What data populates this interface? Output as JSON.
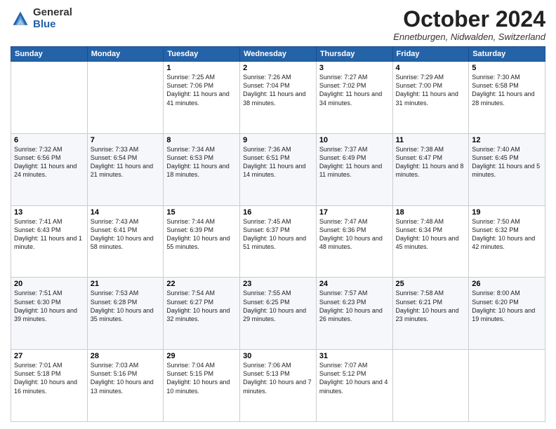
{
  "logo": {
    "general": "General",
    "blue": "Blue"
  },
  "title": "October 2024",
  "location": "Ennetburgen, Nidwalden, Switzerland",
  "days_of_week": [
    "Sunday",
    "Monday",
    "Tuesday",
    "Wednesday",
    "Thursday",
    "Friday",
    "Saturday"
  ],
  "weeks": [
    [
      {
        "day": "",
        "sunrise": "",
        "sunset": "",
        "daylight": ""
      },
      {
        "day": "",
        "sunrise": "",
        "sunset": "",
        "daylight": ""
      },
      {
        "day": "1",
        "sunrise": "Sunrise: 7:25 AM",
        "sunset": "Sunset: 7:06 PM",
        "daylight": "Daylight: 11 hours and 41 minutes."
      },
      {
        "day": "2",
        "sunrise": "Sunrise: 7:26 AM",
        "sunset": "Sunset: 7:04 PM",
        "daylight": "Daylight: 11 hours and 38 minutes."
      },
      {
        "day": "3",
        "sunrise": "Sunrise: 7:27 AM",
        "sunset": "Sunset: 7:02 PM",
        "daylight": "Daylight: 11 hours and 34 minutes."
      },
      {
        "day": "4",
        "sunrise": "Sunrise: 7:29 AM",
        "sunset": "Sunset: 7:00 PM",
        "daylight": "Daylight: 11 hours and 31 minutes."
      },
      {
        "day": "5",
        "sunrise": "Sunrise: 7:30 AM",
        "sunset": "Sunset: 6:58 PM",
        "daylight": "Daylight: 11 hours and 28 minutes."
      }
    ],
    [
      {
        "day": "6",
        "sunrise": "Sunrise: 7:32 AM",
        "sunset": "Sunset: 6:56 PM",
        "daylight": "Daylight: 11 hours and 24 minutes."
      },
      {
        "day": "7",
        "sunrise": "Sunrise: 7:33 AM",
        "sunset": "Sunset: 6:54 PM",
        "daylight": "Daylight: 11 hours and 21 minutes."
      },
      {
        "day": "8",
        "sunrise": "Sunrise: 7:34 AM",
        "sunset": "Sunset: 6:53 PM",
        "daylight": "Daylight: 11 hours and 18 minutes."
      },
      {
        "day": "9",
        "sunrise": "Sunrise: 7:36 AM",
        "sunset": "Sunset: 6:51 PM",
        "daylight": "Daylight: 11 hours and 14 minutes."
      },
      {
        "day": "10",
        "sunrise": "Sunrise: 7:37 AM",
        "sunset": "Sunset: 6:49 PM",
        "daylight": "Daylight: 11 hours and 11 minutes."
      },
      {
        "day": "11",
        "sunrise": "Sunrise: 7:38 AM",
        "sunset": "Sunset: 6:47 PM",
        "daylight": "Daylight: 11 hours and 8 minutes."
      },
      {
        "day": "12",
        "sunrise": "Sunrise: 7:40 AM",
        "sunset": "Sunset: 6:45 PM",
        "daylight": "Daylight: 11 hours and 5 minutes."
      }
    ],
    [
      {
        "day": "13",
        "sunrise": "Sunrise: 7:41 AM",
        "sunset": "Sunset: 6:43 PM",
        "daylight": "Daylight: 11 hours and 1 minute."
      },
      {
        "day": "14",
        "sunrise": "Sunrise: 7:43 AM",
        "sunset": "Sunset: 6:41 PM",
        "daylight": "Daylight: 10 hours and 58 minutes."
      },
      {
        "day": "15",
        "sunrise": "Sunrise: 7:44 AM",
        "sunset": "Sunset: 6:39 PM",
        "daylight": "Daylight: 10 hours and 55 minutes."
      },
      {
        "day": "16",
        "sunrise": "Sunrise: 7:45 AM",
        "sunset": "Sunset: 6:37 PM",
        "daylight": "Daylight: 10 hours and 51 minutes."
      },
      {
        "day": "17",
        "sunrise": "Sunrise: 7:47 AM",
        "sunset": "Sunset: 6:36 PM",
        "daylight": "Daylight: 10 hours and 48 minutes."
      },
      {
        "day": "18",
        "sunrise": "Sunrise: 7:48 AM",
        "sunset": "Sunset: 6:34 PM",
        "daylight": "Daylight: 10 hours and 45 minutes."
      },
      {
        "day": "19",
        "sunrise": "Sunrise: 7:50 AM",
        "sunset": "Sunset: 6:32 PM",
        "daylight": "Daylight: 10 hours and 42 minutes."
      }
    ],
    [
      {
        "day": "20",
        "sunrise": "Sunrise: 7:51 AM",
        "sunset": "Sunset: 6:30 PM",
        "daylight": "Daylight: 10 hours and 39 minutes."
      },
      {
        "day": "21",
        "sunrise": "Sunrise: 7:53 AM",
        "sunset": "Sunset: 6:28 PM",
        "daylight": "Daylight: 10 hours and 35 minutes."
      },
      {
        "day": "22",
        "sunrise": "Sunrise: 7:54 AM",
        "sunset": "Sunset: 6:27 PM",
        "daylight": "Daylight: 10 hours and 32 minutes."
      },
      {
        "day": "23",
        "sunrise": "Sunrise: 7:55 AM",
        "sunset": "Sunset: 6:25 PM",
        "daylight": "Daylight: 10 hours and 29 minutes."
      },
      {
        "day": "24",
        "sunrise": "Sunrise: 7:57 AM",
        "sunset": "Sunset: 6:23 PM",
        "daylight": "Daylight: 10 hours and 26 minutes."
      },
      {
        "day": "25",
        "sunrise": "Sunrise: 7:58 AM",
        "sunset": "Sunset: 6:21 PM",
        "daylight": "Daylight: 10 hours and 23 minutes."
      },
      {
        "day": "26",
        "sunrise": "Sunrise: 8:00 AM",
        "sunset": "Sunset: 6:20 PM",
        "daylight": "Daylight: 10 hours and 19 minutes."
      }
    ],
    [
      {
        "day": "27",
        "sunrise": "Sunrise: 7:01 AM",
        "sunset": "Sunset: 5:18 PM",
        "daylight": "Daylight: 10 hours and 16 minutes."
      },
      {
        "day": "28",
        "sunrise": "Sunrise: 7:03 AM",
        "sunset": "Sunset: 5:16 PM",
        "daylight": "Daylight: 10 hours and 13 minutes."
      },
      {
        "day": "29",
        "sunrise": "Sunrise: 7:04 AM",
        "sunset": "Sunset: 5:15 PM",
        "daylight": "Daylight: 10 hours and 10 minutes."
      },
      {
        "day": "30",
        "sunrise": "Sunrise: 7:06 AM",
        "sunset": "Sunset: 5:13 PM",
        "daylight": "Daylight: 10 hours and 7 minutes."
      },
      {
        "day": "31",
        "sunrise": "Sunrise: 7:07 AM",
        "sunset": "Sunset: 5:12 PM",
        "daylight": "Daylight: 10 hours and 4 minutes."
      },
      {
        "day": "",
        "sunrise": "",
        "sunset": "",
        "daylight": ""
      },
      {
        "day": "",
        "sunrise": "",
        "sunset": "",
        "daylight": ""
      }
    ]
  ]
}
